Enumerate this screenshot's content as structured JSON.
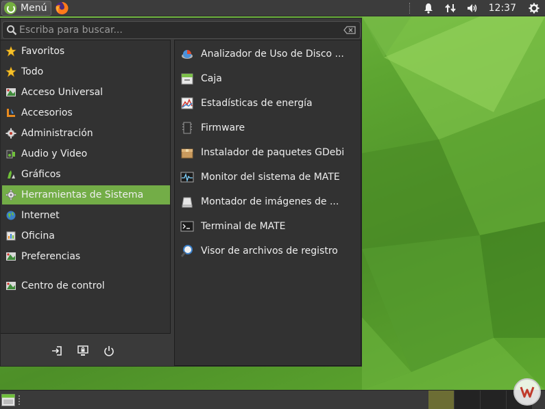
{
  "top_panel": {
    "menu_label": "Menú",
    "clock": "12:37",
    "tray_icons": [
      "bell-icon",
      "network-icon",
      "volume-icon",
      "gear-icon"
    ]
  },
  "search": {
    "placeholder": "Escriba para buscar..."
  },
  "categories": [
    {
      "label": "Favoritos",
      "icon": "star-icon"
    },
    {
      "label": "Todo",
      "icon": "star-icon"
    },
    {
      "label": "Acceso Universal",
      "icon": "accessibility-icon"
    },
    {
      "label": "Accesorios",
      "icon": "accessories-icon"
    },
    {
      "label": "Administración",
      "icon": "administration-icon"
    },
    {
      "label": "Audio y Video",
      "icon": "multimedia-icon"
    },
    {
      "label": "Gráficos",
      "icon": "graphics-icon"
    },
    {
      "label": "Herramientas de Sistema",
      "icon": "system-tools-icon",
      "selected": true
    },
    {
      "label": "Internet",
      "icon": "globe-icon"
    },
    {
      "label": "Oficina",
      "icon": "office-icon"
    },
    {
      "label": "Preferencias",
      "icon": "preferences-icon"
    },
    {
      "label": "Centro de control",
      "icon": "control-center-icon"
    }
  ],
  "apps": [
    {
      "label": "Analizador de Uso de Disco ...",
      "icon": "disk-usage-icon"
    },
    {
      "label": "Caja",
      "icon": "file-manager-icon"
    },
    {
      "label": "Estadísticas de energía",
      "icon": "power-statistics-icon"
    },
    {
      "label": "Firmware",
      "icon": "firmware-icon"
    },
    {
      "label": "Instalador de paquetes GDebi",
      "icon": "package-installer-icon"
    },
    {
      "label": "Monitor del sistema de MATE",
      "icon": "system-monitor-icon"
    },
    {
      "label": "Montador de imágenes de ...",
      "icon": "disk-image-mounter-icon"
    },
    {
      "label": "Terminal de MATE",
      "icon": "terminal-icon"
    },
    {
      "label": "Visor de archivos de registro",
      "icon": "log-viewer-icon"
    }
  ],
  "session_buttons": [
    "logout-icon",
    "lock-screen-icon",
    "power-icon"
  ],
  "colors": {
    "selection": "#73ad47",
    "panel": "#3c3c3c",
    "menu_bg": "#3a3a3a",
    "active_workspace": "#6c6d34"
  }
}
